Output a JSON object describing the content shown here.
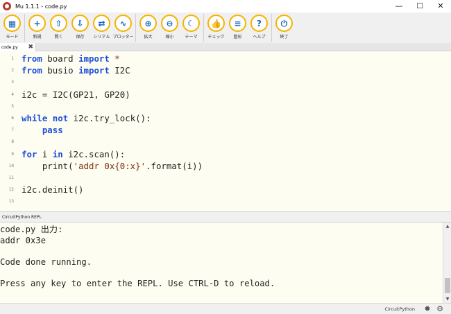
{
  "window": {
    "title": "Mu 1.1.1 - code.py",
    "minimize": "—",
    "maximize": "☐",
    "close": "✕"
  },
  "toolbar": {
    "buttons": [
      {
        "name": "mode",
        "label": "モード",
        "icon": "▦"
      },
      {
        "name": "new",
        "label": "新規",
        "icon": "+"
      },
      {
        "name": "load",
        "label": "開く",
        "icon": "⇧"
      },
      {
        "name": "save",
        "label": "保存",
        "icon": "⇩"
      },
      {
        "name": "serial",
        "label": "シリアル",
        "icon": "⇄"
      },
      {
        "name": "plotter",
        "label": "プロッター",
        "icon": "∿"
      },
      {
        "name": "zoom-in",
        "label": "拡大",
        "icon": "⊕"
      },
      {
        "name": "zoom-out",
        "label": "縮小",
        "icon": "⊖"
      },
      {
        "name": "theme",
        "label": "テーマ",
        "icon": "☾"
      },
      {
        "name": "check",
        "label": "チェック",
        "icon": "👍"
      },
      {
        "name": "tidy",
        "label": "整形",
        "icon": "≡"
      },
      {
        "name": "help",
        "label": "ヘルプ",
        "icon": "?"
      },
      {
        "name": "quit",
        "label": "終了",
        "icon": "⏻"
      }
    ]
  },
  "tab": {
    "filename": "code.py",
    "close": "✖"
  },
  "editor": {
    "line_numbers": [
      "1",
      "2",
      "3",
      "4",
      "5",
      "6",
      "7",
      "8",
      "9",
      "10",
      "11",
      "12",
      "13"
    ],
    "lines": [
      {
        "num": "1",
        "segments": [
          {
            "t": "from",
            "k": "kw"
          },
          {
            "t": " board ",
            "k": "fn"
          },
          {
            "t": "import",
            "k": "kw"
          },
          {
            "t": " *",
            "k": "str"
          }
        ]
      },
      {
        "num": "2",
        "segments": [
          {
            "t": "from",
            "k": "kw"
          },
          {
            "t": " busio ",
            "k": "fn"
          },
          {
            "t": "import",
            "k": "kw"
          },
          {
            "t": " I2C",
            "k": "fn"
          }
        ]
      },
      {
        "num": "3",
        "segments": []
      },
      {
        "num": "4",
        "segments": [
          {
            "t": "i2c = I2C(GP21, GP20)",
            "k": "fn"
          }
        ]
      },
      {
        "num": "5",
        "segments": []
      },
      {
        "num": "6",
        "segments": [
          {
            "t": "while",
            "k": "kw"
          },
          {
            "t": " ",
            "k": "fn"
          },
          {
            "t": "not",
            "k": "kw"
          },
          {
            "t": " i2c.try_lock():",
            "k": "fn"
          }
        ]
      },
      {
        "num": "7",
        "segments": [
          {
            "t": "    ",
            "k": "fn"
          },
          {
            "t": "pass",
            "k": "kw"
          }
        ]
      },
      {
        "num": "8",
        "segments": []
      },
      {
        "num": "9",
        "segments": [
          {
            "t": "for",
            "k": "kw"
          },
          {
            "t": " i ",
            "k": "fn"
          },
          {
            "t": "in",
            "k": "kw"
          },
          {
            "t": " i2c.scan():",
            "k": "fn"
          }
        ]
      },
      {
        "num": "10",
        "segments": [
          {
            "t": "    print(",
            "k": "fn"
          },
          {
            "t": "'addr 0x{0:x}'",
            "k": "str"
          },
          {
            "t": ".format(i))",
            "k": "fn"
          }
        ]
      },
      {
        "num": "11",
        "segments": []
      },
      {
        "num": "12",
        "segments": [
          {
            "t": "i2c.deinit()",
            "k": "fn"
          }
        ]
      },
      {
        "num": "13",
        "segments": []
      }
    ]
  },
  "repl": {
    "tab_label": "CircuitPython REPL",
    "lines": [
      "code.py 出力:",
      "addr 0x3e",
      "",
      "Code done running.",
      "",
      "Press any key to enter the REPL. Use CTRL-D to reload."
    ]
  },
  "status": {
    "mode": "CircuitPython",
    "chip_icon": "chip-icon",
    "settings_icon": "gear-icon"
  },
  "colors": {
    "keyword": "#1d4ed8",
    "string": "#7c2d12",
    "button_ring": "#f4b400",
    "button_icon": "#1565c0",
    "editor_bg": "#fefdf1"
  }
}
